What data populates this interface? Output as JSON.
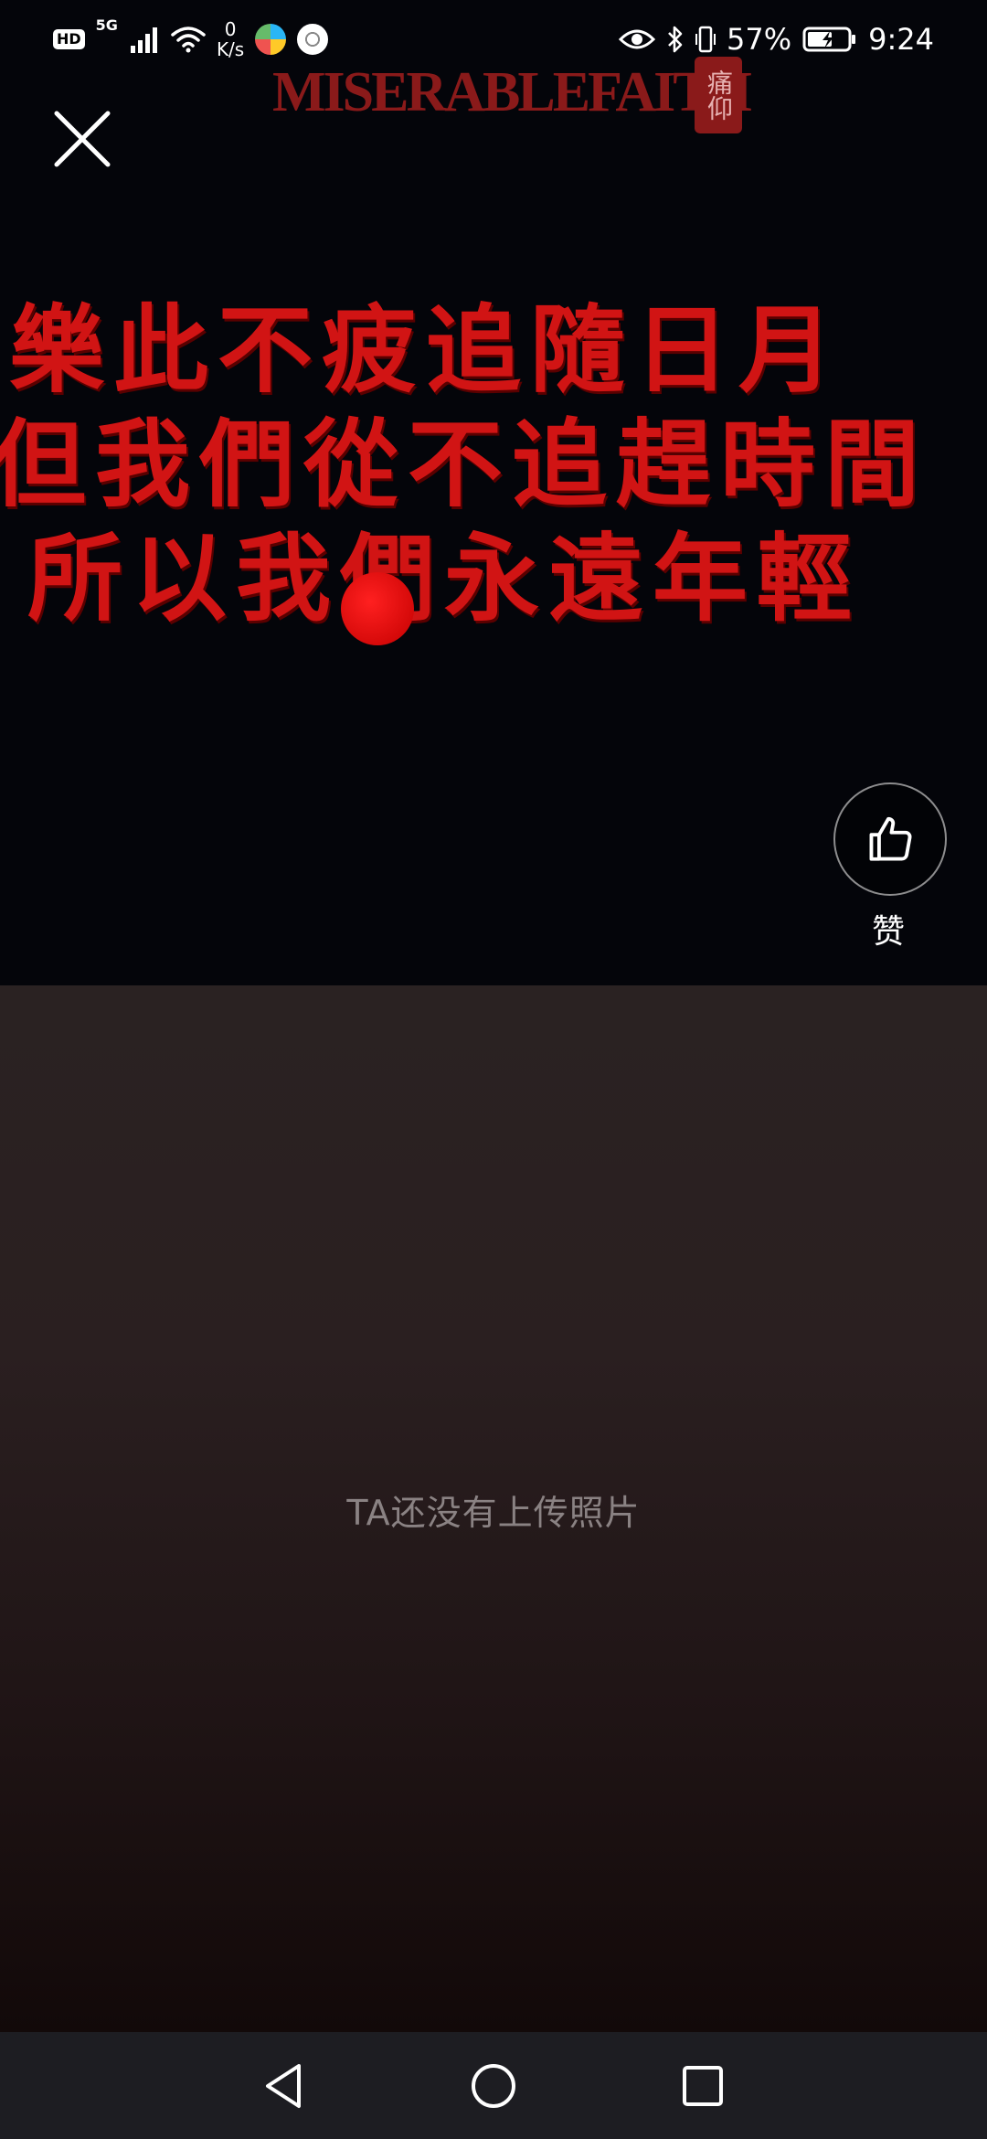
{
  "status_bar": {
    "hd_label": "HD",
    "network_label": "5G",
    "net_speed_value": "0",
    "net_speed_unit": "K/s",
    "battery_percent": "57%",
    "time": "9:24"
  },
  "cover": {
    "brand_title": "MISERABLEFAITH",
    "brand_seal": "痛仰",
    "lyrics": [
      "樂此不疲追隨日月",
      "但我們從不追趕時間",
      "所以我們永遠年輕"
    ],
    "like_label": "赞"
  },
  "gallery": {
    "empty_message": "TA还没有上传照片"
  },
  "colors": {
    "lyric_red": "#d11414",
    "brand_red": "#8a1a1a",
    "nav_bg": "#1d1d22"
  }
}
